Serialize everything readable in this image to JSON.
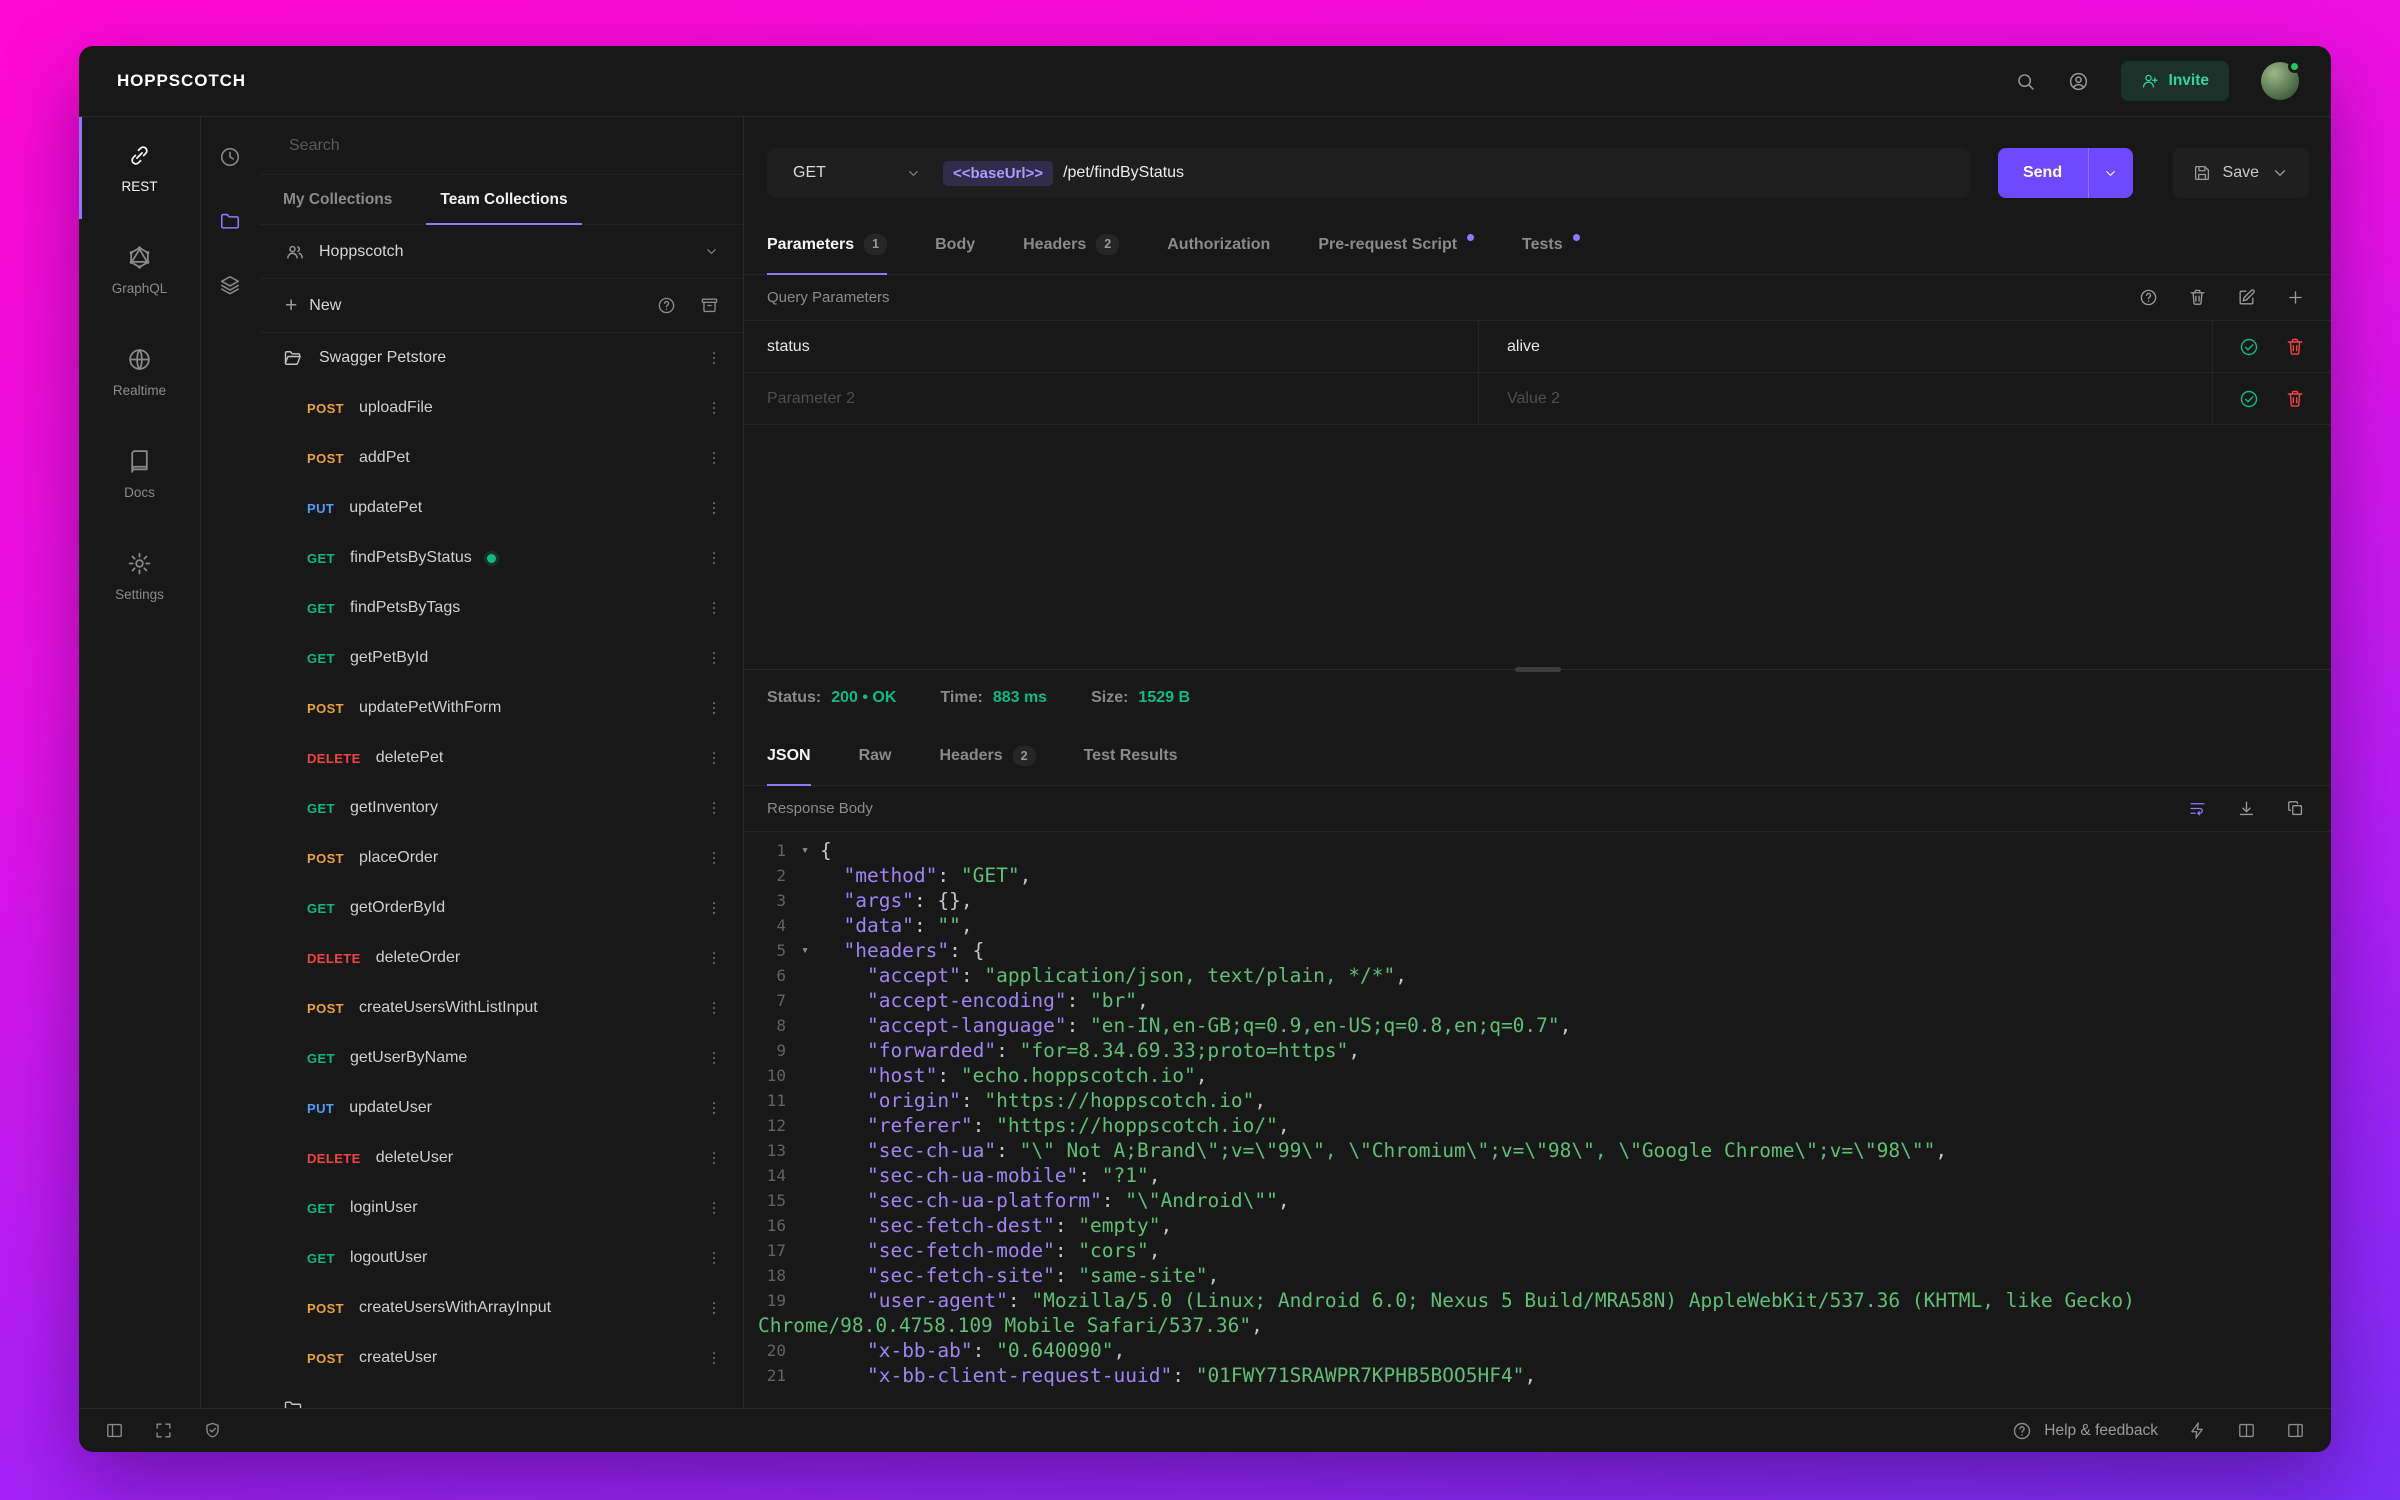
{
  "colors": {
    "accent": "#6d4aff",
    "accent_light": "#8b7bfa",
    "success": "#10b981",
    "danger": "#ef4444",
    "invite_green": "#34d399",
    "methods": {
      "GET": "#10b981",
      "POST": "#e8a33d",
      "PUT": "#4f9cf9",
      "DELETE": "#ef4444"
    }
  },
  "topbar": {
    "logo": "HOPPSCOTCH",
    "invite": "Invite"
  },
  "nav": [
    {
      "id": "rest",
      "label": "REST",
      "icon": "link",
      "active": true
    },
    {
      "id": "graphql",
      "label": "GraphQL",
      "icon": "graphql",
      "active": false
    },
    {
      "id": "realtime",
      "label": "Realtime",
      "icon": "globe",
      "active": false
    },
    {
      "id": "docs",
      "label": "Docs",
      "icon": "book",
      "active": false
    },
    {
      "id": "settings",
      "label": "Settings",
      "icon": "gear",
      "active": false
    }
  ],
  "strip": [
    {
      "id": "history",
      "icon": "clock",
      "active": false
    },
    {
      "id": "collections",
      "icon": "folder",
      "active": true
    },
    {
      "id": "environments",
      "icon": "layers",
      "active": false
    }
  ],
  "collections": {
    "search_placeholder": "Search",
    "tabs": [
      {
        "label": "My Collections",
        "active": false
      },
      {
        "label": "Team Collections",
        "active": true
      }
    ],
    "team": "Hoppscotch",
    "new_label": "New",
    "folder": "Swagger Petstore",
    "partial_next_folder": true,
    "requests": [
      {
        "method": "POST",
        "name": "uploadFile"
      },
      {
        "method": "POST",
        "name": "addPet"
      },
      {
        "method": "PUT",
        "name": "updatePet"
      },
      {
        "method": "GET",
        "name": "findPetsByStatus",
        "active": true
      },
      {
        "method": "GET",
        "name": "findPetsByTags"
      },
      {
        "method": "GET",
        "name": "getPetById"
      },
      {
        "method": "POST",
        "name": "updatePetWithForm"
      },
      {
        "method": "DELETE",
        "name": "deletePet"
      },
      {
        "method": "GET",
        "name": "getInventory"
      },
      {
        "method": "POST",
        "name": "placeOrder"
      },
      {
        "method": "GET",
        "name": "getOrderById"
      },
      {
        "method": "DELETE",
        "name": "deleteOrder"
      },
      {
        "method": "POST",
        "name": "createUsersWithListInput"
      },
      {
        "method": "GET",
        "name": "getUserByName"
      },
      {
        "method": "PUT",
        "name": "updateUser"
      },
      {
        "method": "DELETE",
        "name": "deleteUser"
      },
      {
        "method": "GET",
        "name": "loginUser"
      },
      {
        "method": "GET",
        "name": "logoutUser"
      },
      {
        "method": "POST",
        "name": "createUsersWithArrayInput"
      },
      {
        "method": "POST",
        "name": "createUser"
      }
    ]
  },
  "request": {
    "method": "GET",
    "url_token": "<<baseUrl>>",
    "url_path": "/pet/findByStatus",
    "send": "Send",
    "save": "Save",
    "tabs": [
      {
        "label": "Parameters",
        "badge": "1",
        "active": true
      },
      {
        "label": "Body"
      },
      {
        "label": "Headers",
        "badge": "2"
      },
      {
        "label": "Authorization"
      },
      {
        "label": "Pre-request Script",
        "dot": true
      },
      {
        "label": "Tests",
        "dot": true
      }
    ],
    "section_title": "Query Parameters",
    "params": [
      {
        "key": "status",
        "value": "alive",
        "placeholder": false
      },
      {
        "key": "Parameter 2",
        "value": "Value 2",
        "placeholder": true
      }
    ]
  },
  "response": {
    "status_label": "Status:",
    "status_value": "200 • OK",
    "time_label": "Time:",
    "time_value": "883 ms",
    "size_label": "Size:",
    "size_value": "1529 B",
    "tabs": [
      {
        "label": "JSON",
        "active": true
      },
      {
        "label": "Raw"
      },
      {
        "label": "Headers",
        "badge": "2"
      },
      {
        "label": "Test Results"
      }
    ],
    "body_title": "Response Body",
    "code": [
      {
        "n": "1",
        "fold": true,
        "t": [
          [
            "b",
            "{"
          ]
        ]
      },
      {
        "n": "2",
        "t": [
          [
            "w",
            "  "
          ],
          [
            "k",
            "\"method\""
          ],
          [
            "b",
            ": "
          ],
          [
            "v",
            "\"GET\""
          ],
          [
            "b",
            ","
          ]
        ]
      },
      {
        "n": "3",
        "t": [
          [
            "w",
            "  "
          ],
          [
            "k",
            "\"args\""
          ],
          [
            "b",
            ": {},"
          ]
        ]
      },
      {
        "n": "4",
        "t": [
          [
            "w",
            "  "
          ],
          [
            "k",
            "\"data\""
          ],
          [
            "b",
            ": "
          ],
          [
            "v",
            "\"\""
          ],
          [
            "b",
            ","
          ]
        ]
      },
      {
        "n": "5",
        "fold": true,
        "t": [
          [
            "w",
            "  "
          ],
          [
            "k",
            "\"headers\""
          ],
          [
            "b",
            ": {"
          ]
        ]
      },
      {
        "n": "6",
        "t": [
          [
            "w",
            "    "
          ],
          [
            "k",
            "\"accept\""
          ],
          [
            "b",
            ": "
          ],
          [
            "v",
            "\"application/json, text/plain, */*\""
          ],
          [
            "b",
            ","
          ]
        ]
      },
      {
        "n": "7",
        "t": [
          [
            "w",
            "    "
          ],
          [
            "k",
            "\"accept-encoding\""
          ],
          [
            "b",
            ": "
          ],
          [
            "v",
            "\"br\""
          ],
          [
            "b",
            ","
          ]
        ]
      },
      {
        "n": "8",
        "t": [
          [
            "w",
            "    "
          ],
          [
            "k",
            "\"accept-language\""
          ],
          [
            "b",
            ": "
          ],
          [
            "v",
            "\"en-IN,en-GB;q=0.9,en-US;q=0.8,en;q=0.7\""
          ],
          [
            "b",
            ","
          ]
        ]
      },
      {
        "n": "9",
        "t": [
          [
            "w",
            "    "
          ],
          [
            "k",
            "\"forwarded\""
          ],
          [
            "b",
            ": "
          ],
          [
            "v",
            "\"for=8.34.69.33;proto=https\""
          ],
          [
            "b",
            ","
          ]
        ]
      },
      {
        "n": "10",
        "t": [
          [
            "w",
            "    "
          ],
          [
            "k",
            "\"host\""
          ],
          [
            "b",
            ": "
          ],
          [
            "v",
            "\"echo.hoppscotch.io\""
          ],
          [
            "b",
            ","
          ]
        ]
      },
      {
        "n": "11",
        "t": [
          [
            "w",
            "    "
          ],
          [
            "k",
            "\"origin\""
          ],
          [
            "b",
            ": "
          ],
          [
            "v",
            "\"https://hoppscotch.io\""
          ],
          [
            "b",
            ","
          ]
        ]
      },
      {
        "n": "12",
        "t": [
          [
            "w",
            "    "
          ],
          [
            "k",
            "\"referer\""
          ],
          [
            "b",
            ": "
          ],
          [
            "v",
            "\"https://hoppscotch.io/\""
          ],
          [
            "b",
            ","
          ]
        ]
      },
      {
        "n": "13",
        "t": [
          [
            "w",
            "    "
          ],
          [
            "k",
            "\"sec-ch-ua\""
          ],
          [
            "b",
            ": "
          ],
          [
            "v",
            "\"\\\" Not A;Brand\\\";v=\\\"99\\\", \\\"Chromium\\\";v=\\\"98\\\", \\\"Google Chrome\\\";v=\\\"98\\\"\""
          ],
          [
            "b",
            ","
          ]
        ]
      },
      {
        "n": "14",
        "t": [
          [
            "w",
            "    "
          ],
          [
            "k",
            "\"sec-ch-ua-mobile\""
          ],
          [
            "b",
            ": "
          ],
          [
            "v",
            "\"?1\""
          ],
          [
            "b",
            ","
          ]
        ]
      },
      {
        "n": "15",
        "t": [
          [
            "w",
            "    "
          ],
          [
            "k",
            "\"sec-ch-ua-platform\""
          ],
          [
            "b",
            ": "
          ],
          [
            "v",
            "\"\\\"Android\\\"\""
          ],
          [
            "b",
            ","
          ]
        ]
      },
      {
        "n": "16",
        "t": [
          [
            "w",
            "    "
          ],
          [
            "k",
            "\"sec-fetch-dest\""
          ],
          [
            "b",
            ": "
          ],
          [
            "v",
            "\"empty\""
          ],
          [
            "b",
            ","
          ]
        ]
      },
      {
        "n": "17",
        "t": [
          [
            "w",
            "    "
          ],
          [
            "k",
            "\"sec-fetch-mode\""
          ],
          [
            "b",
            ": "
          ],
          [
            "v",
            "\"cors\""
          ],
          [
            "b",
            ","
          ]
        ]
      },
      {
        "n": "18",
        "t": [
          [
            "w",
            "    "
          ],
          [
            "k",
            "\"sec-fetch-site\""
          ],
          [
            "b",
            ": "
          ],
          [
            "v",
            "\"same-site\""
          ],
          [
            "b",
            ","
          ]
        ]
      },
      {
        "n": "19",
        "t": [
          [
            "w",
            "    "
          ],
          [
            "k",
            "\"user-agent\""
          ],
          [
            "b",
            ": "
          ],
          [
            "v",
            "\"Mozilla/5.0 (Linux; Android 6.0; Nexus 5 Build/MRA58N) AppleWebKit/537.36 (KHTML, like Gecko)"
          ]
        ]
      },
      {
        "cont": true,
        "t": [
          [
            "v",
            "Chrome/98.0.4758.109 Mobile Safari/537.36\""
          ],
          [
            "b",
            ","
          ]
        ]
      },
      {
        "n": "20",
        "t": [
          [
            "w",
            "    "
          ],
          [
            "k",
            "\"x-bb-ab\""
          ],
          [
            "b",
            ": "
          ],
          [
            "v",
            "\"0.640090\""
          ],
          [
            "b",
            ","
          ]
        ]
      },
      {
        "n": "21",
        "t": [
          [
            "w",
            "    "
          ],
          [
            "k",
            "\"x-bb-client-request-uuid\""
          ],
          [
            "b",
            ": "
          ],
          [
            "v",
            "\"01FWY71SRAWPR7KPHB5BOO5HF4\""
          ],
          [
            "b",
            ","
          ]
        ]
      }
    ]
  },
  "bottombar": {
    "help": "Help & feedback"
  }
}
